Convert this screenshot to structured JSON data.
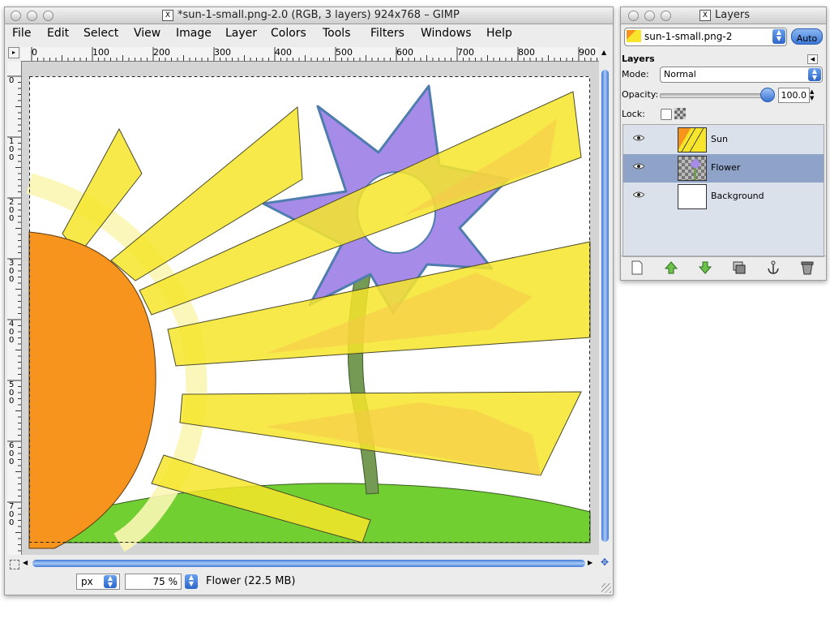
{
  "main_window": {
    "title": "*sun-1-small.png-2.0 (RGB, 3 layers) 924x768 – GIMP",
    "menu": [
      "File",
      "Edit",
      "Select",
      "View",
      "Image",
      "Layer",
      "Colors",
      "Tools",
      "Filters",
      "Windows",
      "Help"
    ],
    "ruler_h_labels": [
      "0",
      "100",
      "200",
      "300",
      "400",
      "500",
      "600",
      "700",
      "800",
      "900"
    ],
    "ruler_v_labels": [
      "0",
      "1 0 0",
      "2 0 0",
      "3 0 0",
      "4 0 0",
      "5 0 0",
      "6 0 0",
      "7 0 0"
    ],
    "status": {
      "unit": "px",
      "zoom": "75 %",
      "layer_info": "Flower (22.5 MB)"
    }
  },
  "layers_window": {
    "title": "Layers",
    "image_select": "sun-1-small.png-2",
    "auto_button": "Auto",
    "section_label": "Layers",
    "mode_label": "Mode:",
    "mode_value": "Normal",
    "opacity_label": "Opacity:",
    "opacity_value": "100.0",
    "opacity_fraction": 1.0,
    "lock_label": "Lock:",
    "layers": [
      {
        "name": "Sun",
        "visible": true,
        "selected": false
      },
      {
        "name": "Flower",
        "visible": true,
        "selected": true
      },
      {
        "name": "Background",
        "visible": true,
        "selected": false
      }
    ]
  },
  "colors": {
    "selection": "#8fa3c8",
    "list_bg": "#dbe1ea",
    "sun_orange": "#f7941d",
    "ray_yellow": "#f6e52a",
    "flower_purple": "#a78be8",
    "grass_green": "#72cf32"
  },
  "icons": [
    "x11-icon",
    "close-icon",
    "minimize-icon",
    "zoom-icon",
    "eye-icon",
    "new-layer-icon",
    "raise-layer-icon",
    "lower-layer-icon",
    "duplicate-layer-icon",
    "anchor-layer-icon",
    "delete-layer-icon",
    "navigate-icon",
    "quickmask-icon"
  ]
}
